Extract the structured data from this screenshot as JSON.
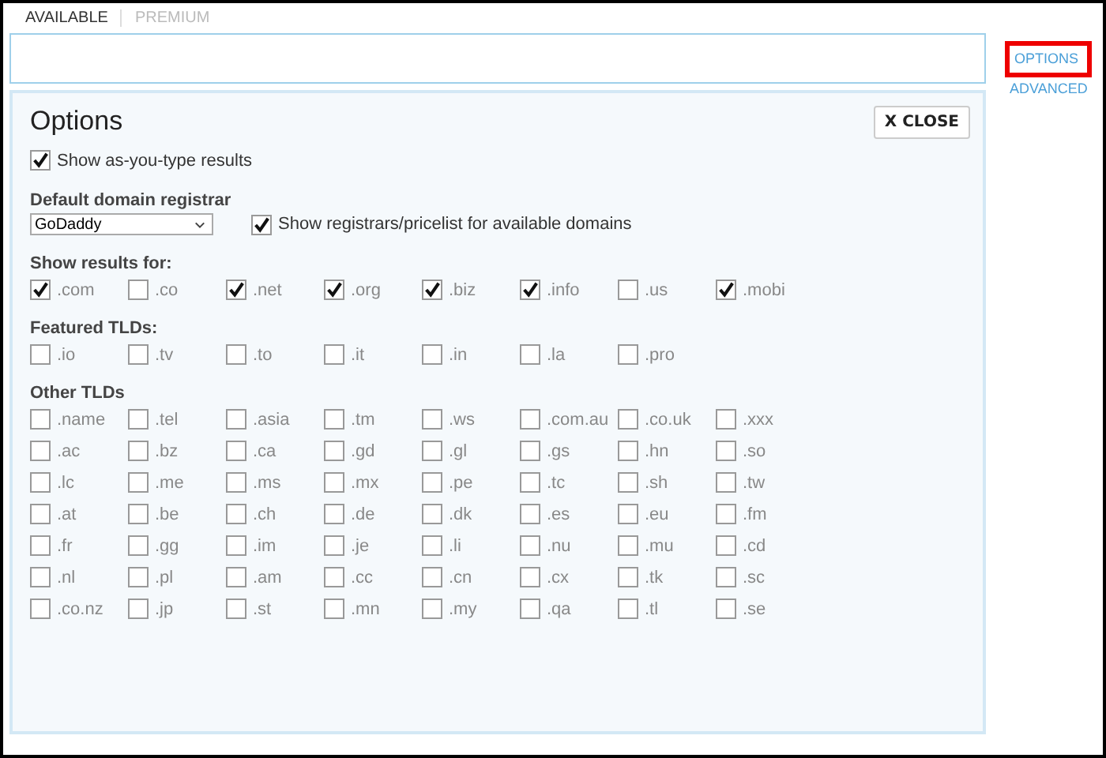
{
  "tabs": [
    {
      "label": "AVAILABLE",
      "selected": true
    },
    {
      "label": "PREMIUM",
      "selected": false
    }
  ],
  "side_links": [
    {
      "label": "OPTIONS",
      "highlighted": true
    },
    {
      "label": "ADVANCED",
      "highlighted": false
    }
  ],
  "options": {
    "title": "Options",
    "close_button": "X CLOSE",
    "as_you_type": {
      "label": "Show as-you-type results",
      "checked": true
    },
    "registrar": {
      "heading": "Default domain registrar",
      "value": "GoDaddy",
      "pricelist": {
        "label": "Show registrars/pricelist for available domains",
        "checked": true
      }
    },
    "groups": [
      {
        "heading": "Show results for:",
        "items": [
          {
            "label": ".com",
            "checked": true
          },
          {
            "label": ".co",
            "checked": false
          },
          {
            "label": ".net",
            "checked": true
          },
          {
            "label": ".org",
            "checked": true
          },
          {
            "label": ".biz",
            "checked": true
          },
          {
            "label": ".info",
            "checked": true
          },
          {
            "label": ".us",
            "checked": false
          },
          {
            "label": ".mobi",
            "checked": true
          }
        ]
      },
      {
        "heading": "Featured TLDs:",
        "items": [
          {
            "label": ".io",
            "checked": false
          },
          {
            "label": ".tv",
            "checked": false
          },
          {
            "label": ".to",
            "checked": false
          },
          {
            "label": ".it",
            "checked": false
          },
          {
            "label": ".in",
            "checked": false
          },
          {
            "label": ".la",
            "checked": false
          },
          {
            "label": ".pro",
            "checked": false
          }
        ]
      },
      {
        "heading": "Other TLDs",
        "items": [
          {
            "label": ".name",
            "checked": false
          },
          {
            "label": ".tel",
            "checked": false
          },
          {
            "label": ".asia",
            "checked": false
          },
          {
            "label": ".tm",
            "checked": false
          },
          {
            "label": ".ws",
            "checked": false
          },
          {
            "label": ".com.au",
            "checked": false
          },
          {
            "label": ".co.uk",
            "checked": false
          },
          {
            "label": ".xxx",
            "checked": false
          },
          {
            "label": ".ac",
            "checked": false
          },
          {
            "label": ".bz",
            "checked": false
          },
          {
            "label": ".ca",
            "checked": false
          },
          {
            "label": ".gd",
            "checked": false
          },
          {
            "label": ".gl",
            "checked": false
          },
          {
            "label": ".gs",
            "checked": false
          },
          {
            "label": ".hn",
            "checked": false
          },
          {
            "label": ".so",
            "checked": false
          },
          {
            "label": ".lc",
            "checked": false
          },
          {
            "label": ".me",
            "checked": false
          },
          {
            "label": ".ms",
            "checked": false
          },
          {
            "label": ".mx",
            "checked": false
          },
          {
            "label": ".pe",
            "checked": false
          },
          {
            "label": ".tc",
            "checked": false
          },
          {
            "label": ".sh",
            "checked": false
          },
          {
            "label": ".tw",
            "checked": false
          },
          {
            "label": ".at",
            "checked": false
          },
          {
            "label": ".be",
            "checked": false
          },
          {
            "label": ".ch",
            "checked": false
          },
          {
            "label": ".de",
            "checked": false
          },
          {
            "label": ".dk",
            "checked": false
          },
          {
            "label": ".es",
            "checked": false
          },
          {
            "label": ".eu",
            "checked": false
          },
          {
            "label": ".fm",
            "checked": false
          },
          {
            "label": ".fr",
            "checked": false
          },
          {
            "label": ".gg",
            "checked": false
          },
          {
            "label": ".im",
            "checked": false
          },
          {
            "label": ".je",
            "checked": false
          },
          {
            "label": ".li",
            "checked": false
          },
          {
            "label": ".nu",
            "checked": false
          },
          {
            "label": ".mu",
            "checked": false
          },
          {
            "label": ".cd",
            "checked": false
          },
          {
            "label": ".nl",
            "checked": false
          },
          {
            "label": ".pl",
            "checked": false
          },
          {
            "label": ".am",
            "checked": false
          },
          {
            "label": ".cc",
            "checked": false
          },
          {
            "label": ".cn",
            "checked": false
          },
          {
            "label": ".cx",
            "checked": false
          },
          {
            "label": ".tk",
            "checked": false
          },
          {
            "label": ".sc",
            "checked": false
          },
          {
            "label": ".co.nz",
            "checked": false
          },
          {
            "label": ".jp",
            "checked": false
          },
          {
            "label": ".st",
            "checked": false
          },
          {
            "label": ".mn",
            "checked": false
          },
          {
            "label": ".my",
            "checked": false
          },
          {
            "label": ".qa",
            "checked": false
          },
          {
            "label": ".tl",
            "checked": false
          },
          {
            "label": ".se",
            "checked": false
          }
        ]
      }
    ]
  }
}
